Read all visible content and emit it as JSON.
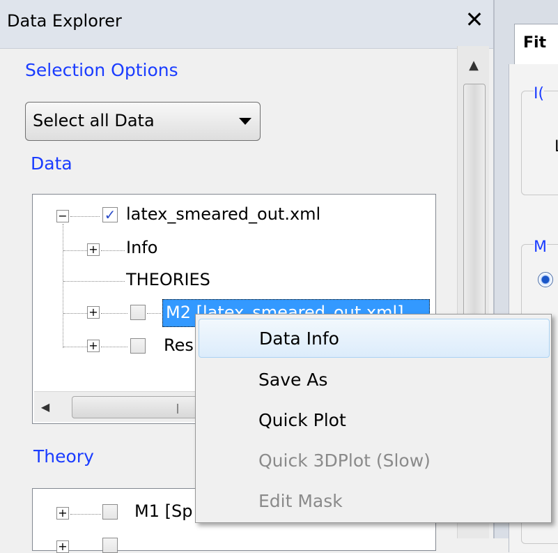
{
  "panel": {
    "title": "Data Explorer",
    "close_glyph": "✕",
    "selection_options_label": "Selection Options",
    "dropdown_value": "Select all Data",
    "data_label": "Data",
    "theory_label": "Theory"
  },
  "data_tree": {
    "root": {
      "label": "latex_smeared_out.xml",
      "checked": true,
      "expander": "⊟"
    },
    "items": [
      {
        "label": "Info",
        "expander": "+"
      },
      {
        "label": "THEORIES"
      },
      {
        "label": "M2 [latex_smeared_out.xml]",
        "expander": "+",
        "selected": true
      },
      {
        "label": "Res",
        "expander": "+"
      }
    ]
  },
  "theory_tree": {
    "items": [
      {
        "label": "M1 [Sp",
        "expander": "+"
      }
    ]
  },
  "right_panel": {
    "tab_label": "Fit",
    "group1_label": "I(",
    "group1_text": "L",
    "group2_label": "M"
  },
  "context_menu": {
    "items": [
      {
        "label": "Data Info",
        "state": "hover"
      },
      {
        "label": "Save As",
        "state": "enabled"
      },
      {
        "label": "Quick Plot",
        "state": "enabled"
      },
      {
        "label": "Quick 3DPlot (Slow)",
        "state": "disabled"
      },
      {
        "label": "Edit Mask",
        "state": "disabled"
      }
    ]
  },
  "icons": {
    "close": "close-icon",
    "dropdown_arrow": "chevron-down-icon",
    "scroll_up": "scroll-up-icon",
    "scroll_left": "scroll-left-icon",
    "checkbox_checked": "checkmark-icon"
  },
  "colors": {
    "label_blue": "#1a3cff",
    "selection_blue": "#3399ff",
    "titlebar": "#dfe4ec"
  }
}
